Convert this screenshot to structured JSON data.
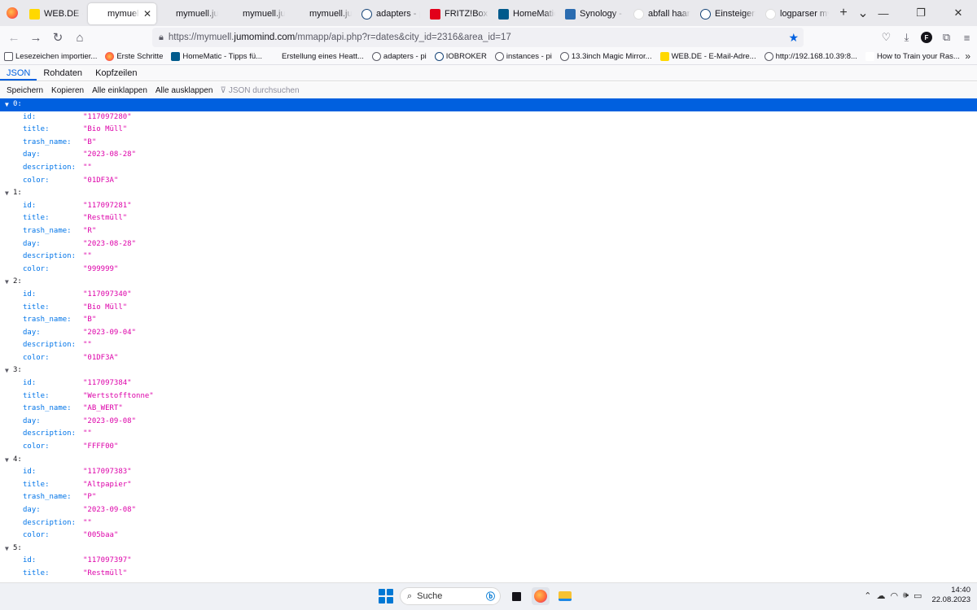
{
  "browser": {
    "tabs": [
      {
        "label": "WEB.DE - E-Mail",
        "favicon": "webde-icon",
        "active": false
      },
      {
        "label": "mymuell.jumomind",
        "favicon": "page-icon",
        "active": true
      },
      {
        "label": "mymuell.jumomind",
        "favicon": "page-icon",
        "active": false
      },
      {
        "label": "mymuell.jumomind",
        "favicon": "page-icon",
        "active": false
      },
      {
        "label": "mymuell.jumomind",
        "favicon": "page-icon",
        "active": false
      },
      {
        "label": "adapters - pi",
        "favicon": "iobroker-icon",
        "active": false
      },
      {
        "label": "FRITZ!Box",
        "favicon": "fritzbox-icon",
        "active": false
      },
      {
        "label": "HomeMatic WebUI",
        "favicon": "homematic-icon",
        "active": false
      },
      {
        "label": "Synology - Sync",
        "favicon": "synology-icon",
        "active": false
      },
      {
        "label": "abfall haan ical",
        "favicon": "google-icon",
        "active": false
      },
      {
        "label": "Einsteigerfragen",
        "favicon": "iobroker-icon",
        "active": false
      },
      {
        "label": "logparser mymuell",
        "favicon": "google-icon",
        "active": false
      }
    ],
    "url_prefix": "https://mymuell.",
    "url_domain": "jumomind.com",
    "url_suffix": "/mmapp/api.php?r=dates&city_id=2316&area_id=17",
    "account_initial": "F",
    "bookmarks": [
      {
        "label": "Lesezeichen importier...",
        "icon": "import-icon"
      },
      {
        "label": "Erste Schritte",
        "icon": "firefox-icon"
      },
      {
        "label": "HomeMatic - Tipps fü...",
        "icon": "homematic-icon"
      },
      {
        "label": "Erstellung eines Heatt...",
        "icon": "page-icon"
      },
      {
        "label": "adapters - pi",
        "icon": "globe-icon"
      },
      {
        "label": "IOBROKER",
        "icon": "iobroker-icon"
      },
      {
        "label": "instances - pi",
        "icon": "globe-icon"
      },
      {
        "label": "13.3inch Magic Mirror...",
        "icon": "globe-icon"
      },
      {
        "label": "WEB.DE - E-Mail-Adre...",
        "icon": "webde-icon"
      },
      {
        "label": "http://192.168.10.39:8...",
        "icon": "globe-icon"
      },
      {
        "label": "How to Train your Ras...",
        "icon": "t-icon"
      }
    ]
  },
  "viewer": {
    "tabs": [
      "JSON",
      "Rohdaten",
      "Kopfzeilen"
    ],
    "toolbar": [
      "Speichern",
      "Kopieren",
      "Alle einklappen",
      "Alle ausklappen"
    ],
    "filter_placeholder": "JSON durchsuchen"
  },
  "json_items": [
    {
      "index": "0:",
      "fields": [
        {
          "key": "id:",
          "value": "\"117097280\""
        },
        {
          "key": "title:",
          "value": "\"Bio Müll\""
        },
        {
          "key": "trash_name:",
          "value": "\"B\""
        },
        {
          "key": "day:",
          "value": "\"2023-08-28\""
        },
        {
          "key": "description:",
          "value": "\"\""
        },
        {
          "key": "color:",
          "value": "\"01DF3A\""
        }
      ]
    },
    {
      "index": "1:",
      "fields": [
        {
          "key": "id:",
          "value": "\"117097281\""
        },
        {
          "key": "title:",
          "value": "\"Restmüll\""
        },
        {
          "key": "trash_name:",
          "value": "\"R\""
        },
        {
          "key": "day:",
          "value": "\"2023-08-28\""
        },
        {
          "key": "description:",
          "value": "\"\""
        },
        {
          "key": "color:",
          "value": "\"999999\""
        }
      ]
    },
    {
      "index": "2:",
      "fields": [
        {
          "key": "id:",
          "value": "\"117097340\""
        },
        {
          "key": "title:",
          "value": "\"Bio Müll\""
        },
        {
          "key": "trash_name:",
          "value": "\"B\""
        },
        {
          "key": "day:",
          "value": "\"2023-09-04\""
        },
        {
          "key": "description:",
          "value": "\"\""
        },
        {
          "key": "color:",
          "value": "\"01DF3A\""
        }
      ]
    },
    {
      "index": "3:",
      "fields": [
        {
          "key": "id:",
          "value": "\"117097384\""
        },
        {
          "key": "title:",
          "value": "\"Wertstofftonne\""
        },
        {
          "key": "trash_name:",
          "value": "\"AB_WERT\""
        },
        {
          "key": "day:",
          "value": "\"2023-09-08\""
        },
        {
          "key": "description:",
          "value": "\"\""
        },
        {
          "key": "color:",
          "value": "\"FFFF00\""
        }
      ]
    },
    {
      "index": "4:",
      "fields": [
        {
          "key": "id:",
          "value": "\"117097383\""
        },
        {
          "key": "title:",
          "value": "\"Altpapier\""
        },
        {
          "key": "trash_name:",
          "value": "\"P\""
        },
        {
          "key": "day:",
          "value": "\"2023-09-08\""
        },
        {
          "key": "description:",
          "value": "\"\""
        },
        {
          "key": "color:",
          "value": "\"005baa\""
        }
      ]
    },
    {
      "index": "5:",
      "fields": [
        {
          "key": "id:",
          "value": "\"117097397\""
        },
        {
          "key": "title:",
          "value": "\"Restmüll\""
        }
      ]
    }
  ],
  "taskbar": {
    "search_label": "Suche",
    "time": "14:40",
    "date": "22.08.2023"
  },
  "colors": {
    "accent": "#0060df",
    "key": "#0074e8",
    "string": "#dd00a9"
  }
}
